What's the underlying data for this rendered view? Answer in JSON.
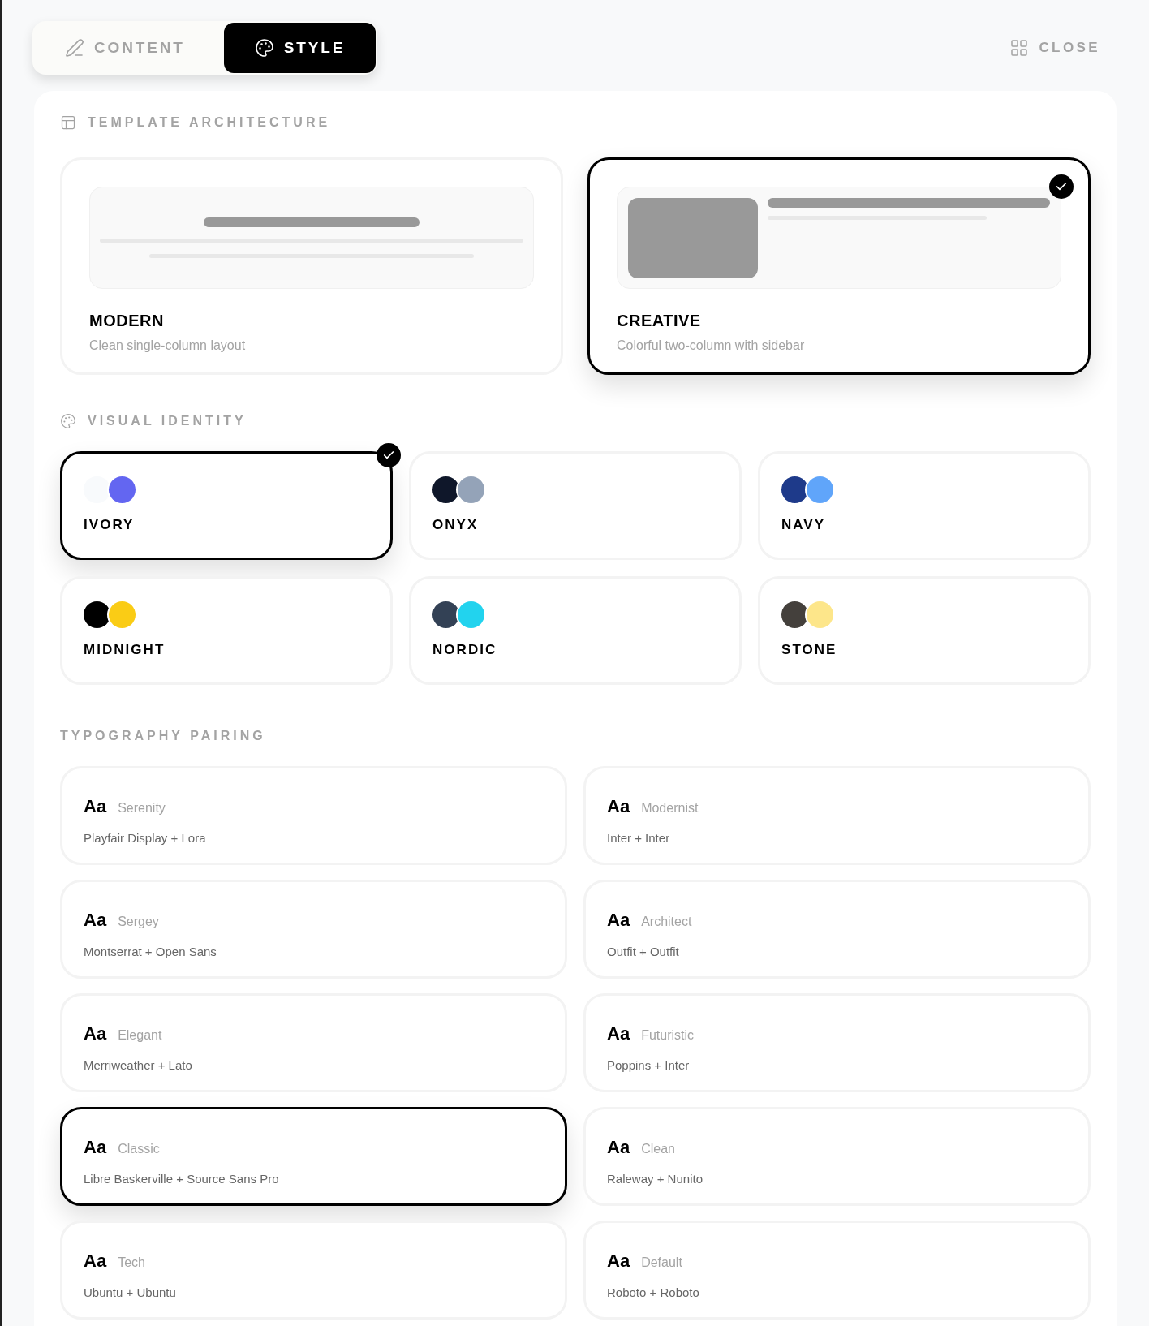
{
  "tabs": [
    {
      "label": "CONTENT",
      "selected": false
    },
    {
      "label": "STYLE",
      "selected": true
    }
  ],
  "close": {
    "label": "CLOSE"
  },
  "templates": {
    "title": "TEMPLATE ARCHITECTURE",
    "items": [
      {
        "name": "MODERN",
        "description": "Clean single-column layout",
        "kind": "single",
        "selected": false
      },
      {
        "name": "CREATIVE",
        "description": "Colorful two-column with sidebar",
        "kind": "sidebar",
        "selected": true
      }
    ]
  },
  "themes": {
    "title": "VISUAL IDENTITY",
    "items": [
      {
        "name": "IVORY",
        "swatches": [
          {
            "color": "#f8fafc"
          },
          {
            "color": "#6366f1"
          }
        ],
        "selected": true
      },
      {
        "name": "ONYX",
        "swatches": [
          {
            "color": "#0f172a"
          },
          {
            "color": "#94a3b8"
          }
        ],
        "selected": false
      },
      {
        "name": "NAVY",
        "swatches": [
          {
            "color": "#1e3a8a"
          },
          {
            "color": "#60a5fa"
          }
        ],
        "selected": false
      },
      {
        "name": "MIDNIGHT",
        "swatches": [
          {
            "color": "#000000"
          },
          {
            "color": "#facc15"
          }
        ],
        "selected": false
      },
      {
        "name": "NORDIC",
        "swatches": [
          {
            "color": "#334155"
          },
          {
            "color": "#22d3ee"
          }
        ],
        "selected": false
      },
      {
        "name": "STONE",
        "swatches": [
          {
            "color": "#44403c"
          },
          {
            "color": "#fde68a"
          }
        ],
        "selected": false
      }
    ]
  },
  "typography": {
    "title": "TYPOGRAPHY PAIRING",
    "items": [
      {
        "sample": "Aa",
        "name": "Serenity",
        "fonts": "Playfair Display + Lora",
        "selected": false
      },
      {
        "sample": "Aa",
        "name": "Modernist",
        "fonts": "Inter + Inter",
        "selected": false
      },
      {
        "sample": "Aa",
        "name": "Sergey",
        "fonts": "Montserrat + Open Sans",
        "selected": false
      },
      {
        "sample": "Aa",
        "name": "Architect",
        "fonts": "Outfit + Outfit",
        "selected": false
      },
      {
        "sample": "Aa",
        "name": "Elegant",
        "fonts": "Merriweather + Lato",
        "selected": false
      },
      {
        "sample": "Aa",
        "name": "Futuristic",
        "fonts": "Poppins + Inter",
        "selected": false
      },
      {
        "sample": "Aa",
        "name": "Classic",
        "fonts": "Libre Baskerville + Source Sans Pro",
        "selected": true
      },
      {
        "sample": "Aa",
        "name": "Clean",
        "fonts": "Raleway + Nunito",
        "selected": false
      },
      {
        "sample": "Aa",
        "name": "Tech",
        "fonts": "Ubuntu + Ubuntu",
        "selected": false
      },
      {
        "sample": "Aa",
        "name": "Default",
        "fonts": "Roboto + Roboto",
        "selected": false
      }
    ]
  }
}
